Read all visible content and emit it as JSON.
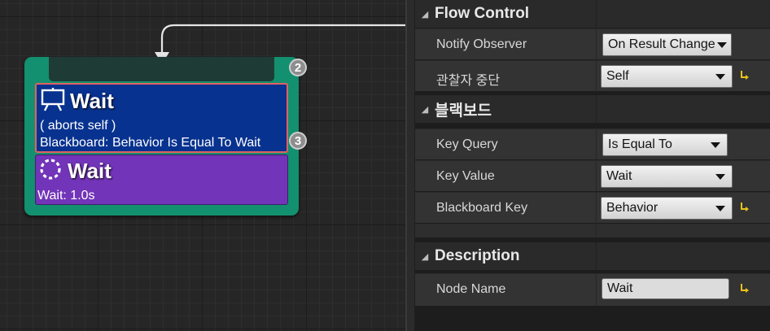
{
  "graph": {
    "node": {
      "badges": {
        "top": "2",
        "decorator": "3"
      },
      "decorator": {
        "icon": "blackboard-decorator-icon",
        "title": "Wait",
        "line1": "( aborts self )",
        "line2": "Blackboard: Behavior Is Equal To Wait"
      },
      "task": {
        "icon": "wait-task-icon",
        "title": "Wait",
        "line1": "Wait: 1.0s"
      }
    }
  },
  "details": {
    "flow_control": {
      "header": "Flow Control",
      "notify_observer": {
        "label": "Notify Observer",
        "value": "On Result Change"
      },
      "observer_aborts": {
        "label": "관찰자 중단",
        "value": "Self"
      }
    },
    "blackboard": {
      "header": "블랙보드",
      "key_query": {
        "label": "Key Query",
        "value": "Is Equal To"
      },
      "key_value": {
        "label": "Key Value",
        "value": "Wait"
      },
      "blackboard_key": {
        "label": "Blackboard Key",
        "value": "Behavior"
      }
    },
    "description": {
      "header": "Description",
      "node_name": {
        "label": "Node Name",
        "value": "Wait"
      }
    }
  },
  "colors": {
    "node_body": "#13906f",
    "decorator": "#08328f",
    "decorator_outline": "#e06262",
    "task": "#7234b8",
    "reset_arrow": "#e8c21b"
  }
}
